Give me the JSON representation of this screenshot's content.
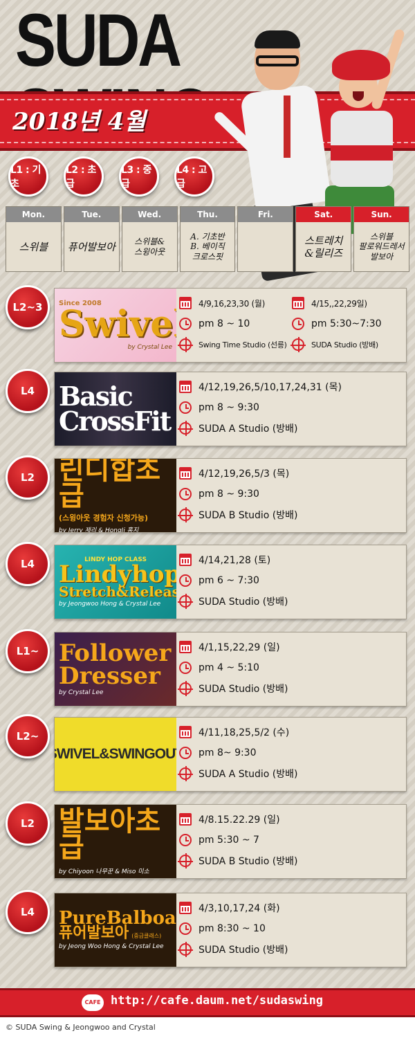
{
  "header": {
    "title": "SUDA SWING",
    "month": "2018년 4월"
  },
  "levels": [
    "L1 : 기초",
    "L2 : 초급",
    "L3 : 중급",
    "L4 : 고급"
  ],
  "week": [
    {
      "day": "Mon.",
      "text": "스위블"
    },
    {
      "day": "Tue.",
      "text": "퓨어발보아"
    },
    {
      "day": "Wed.",
      "text": "스위블&\n스윙아웃"
    },
    {
      "day": "Thu.",
      "text": "A. 기초반\nB. 베이직\n크로스핏"
    },
    {
      "day": "Fri.",
      "text": ""
    },
    {
      "day": "Sat.",
      "text": "스트레치\n&릴리즈"
    },
    {
      "day": "Sun.",
      "text": "스위블\n팔로워드레서\n발보아"
    }
  ],
  "classes": [
    {
      "level": "L2~3",
      "poster": {
        "title": "Swivel",
        "top": "Since 2008",
        "sub": "by Crystal Lee"
      },
      "dates": "4/9,16,23,30 (월)",
      "dates2": "4/15,,22,29일)",
      "time": "pm 8 ~ 10",
      "time2": "pm 5:30~7:30",
      "place": "Swing Time Studio (선릉)",
      "place2": "SUDA Studio (방배)"
    },
    {
      "level": "L4",
      "poster": {
        "title": "Basic CrossFit",
        "sub": ""
      },
      "dates": "4/12,19,26,5/10,17,24,31 (목)",
      "time": "pm 8 ~ 9:30",
      "place": "SUDA A Studio (방배)"
    },
    {
      "level": "L2",
      "poster": {
        "title": "린디합초급",
        "top": "(스윙아웃 경험자 신청가능)",
        "sub": "by Jerry 제리 & HongJi 홍지"
      },
      "dates": "4/12,19,26,5/3 (목)",
      "time": "pm 8 ~ 9:30",
      "place": "SUDA B Studio (방배)"
    },
    {
      "level": "L4",
      "poster": {
        "title": "Lindyhop",
        "top": "LINDY HOP CLASS",
        "title2": "Stretch&Release",
        "sub": "by Jeongwoo Hong & Crystal Lee"
      },
      "dates": "4/14,21,28 (토)",
      "time": "pm 6 ~ 7:30",
      "place": "SUDA Studio (방배)"
    },
    {
      "level": "L1~",
      "poster": {
        "title": "Follower",
        "title2": "Dresser",
        "sub": "by Crystal Lee"
      },
      "dates": "4/1,15,22,29 (일)",
      "time": "pm 4 ~ 5:10",
      "place": "SUDA Studio (방배)"
    },
    {
      "level": "L2~",
      "poster": {
        "title": "SWIVEL&SWINGOUT",
        "sub": ""
      },
      "dates": "4/11,18,25,5/2 (수)",
      "time": "pm 8~ 9:30",
      "place": "SUDA A Studio (방배)"
    },
    {
      "level": "L2",
      "poster": {
        "title": "발보아초급",
        "sub": "by Chiyoon 나무꾼 & Miso 미소"
      },
      "dates": "4/8.15.22.29 (일)",
      "time": "pm 5:30 ~ 7",
      "place": "SUDA B Studio (방배)"
    },
    {
      "level": "L4",
      "poster": {
        "title": "PureBalboaoa",
        "title2": "퓨어발보아",
        "top": "(중급클래스)",
        "sub": "by Jeong Woo Hong & Crystal Lee"
      },
      "dates": "4/3,10,17,24 (화)",
      "time": "pm 8:30 ~ 10",
      "place": "SUDA Studio (방배)"
    }
  ],
  "footer": {
    "cafe_label": "CAFE",
    "url": "http://cafe.daum.net/sudaswing",
    "copyright": "© SUDA Swing & Jeongwoo and Crystal"
  },
  "colors": {
    "accent": "#d7202a",
    "background": "#d9d3c7"
  }
}
